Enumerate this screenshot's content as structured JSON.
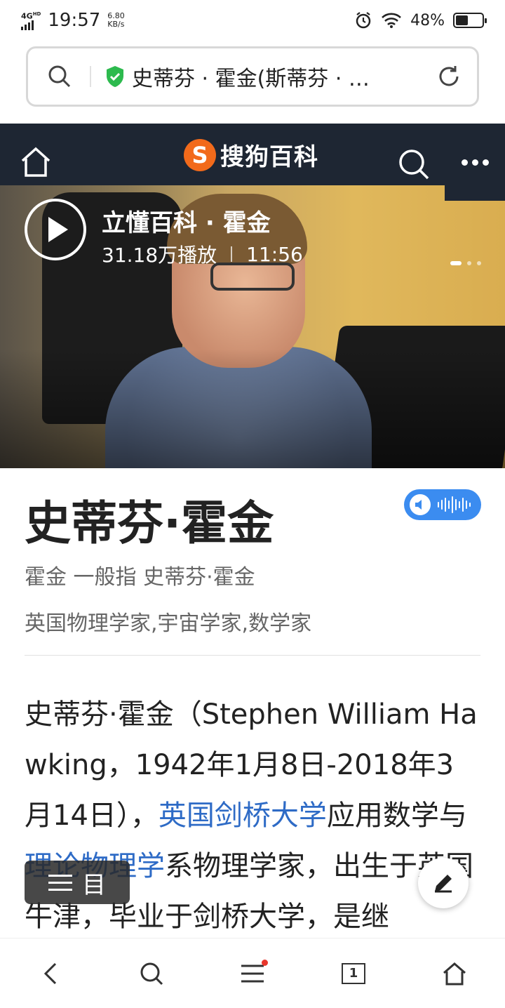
{
  "status_bar": {
    "network": "4G",
    "network_sup": "HD",
    "time": "19:57",
    "speed_value": "6.80",
    "speed_unit": "KB/s",
    "battery": "48%",
    "battery_level": 0.48
  },
  "browser": {
    "url_title": "史蒂芬 · 霍金(斯蒂芬 · …"
  },
  "site": {
    "logo_letter": "S",
    "logo_text": "搜狗百科"
  },
  "video": {
    "title": "立懂百科 · 霍金",
    "plays": "31.18万播放",
    "duration": "11:56",
    "slide_count": 3,
    "active_slide": 1
  },
  "entry": {
    "title": "史蒂芬·霍金",
    "disambiguation": "霍金 一般指 史蒂芬·霍金",
    "tags": "英国物理学家,宇宙学家,数学家",
    "paragraph": {
      "p1": "史蒂芬·霍金（Stephen William Hawking，1942年1月8日-2018年3月14日），",
      "link1": "英国剑桥大学",
      "p2": "应用数学与",
      "link2": "理论物理学",
      "p3": "系物理学家，出生于英国牛津，毕业于剑桥大学，是继"
    }
  },
  "toc": {
    "label": "目"
  },
  "bottom_nav": {
    "tab_count": "1"
  },
  "colors": {
    "header_bg": "#1e2633",
    "logo_orange": "#f26a1b",
    "link_blue": "#2e6bc6",
    "voice_blue": "#3b8cf0",
    "shield_green": "#2dba4e"
  }
}
